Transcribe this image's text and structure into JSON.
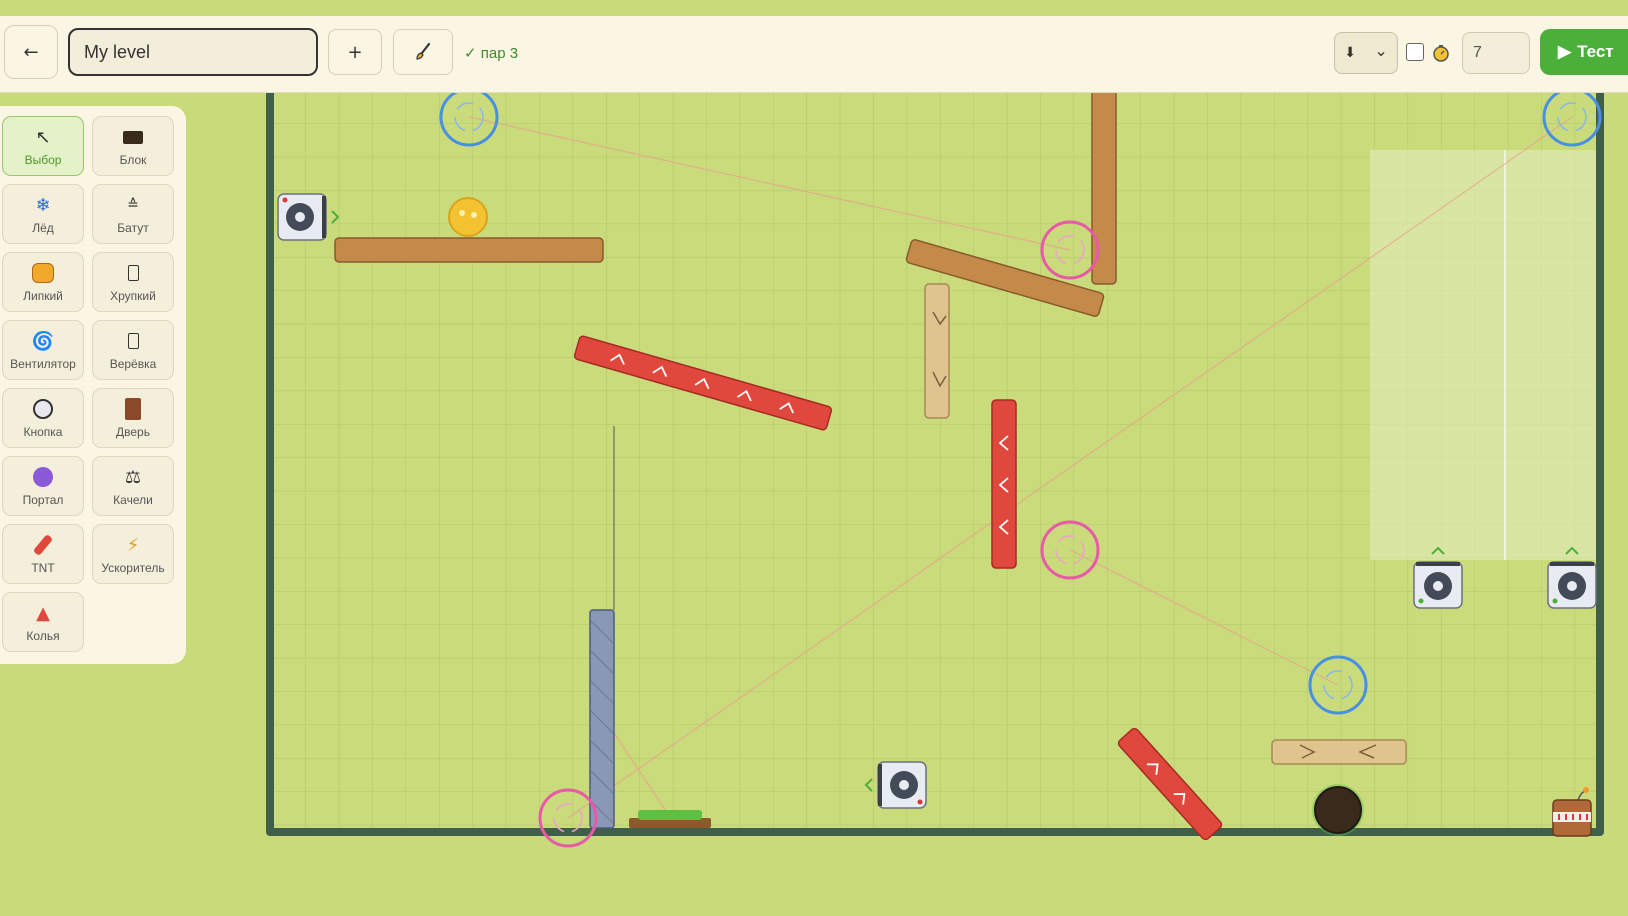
{
  "toolbar": {
    "back_label": "←",
    "level_name": "My level",
    "add_label": "+",
    "par_text": "✓ пар 3",
    "gravity_arrow": "⬇",
    "gravity_chevron": "⌄",
    "timer_value": "7",
    "test_label": "Тест",
    "timer_enabled": false
  },
  "palette": {
    "tools": [
      {
        "label": "Выбор",
        "icon": "cursor-icon",
        "active": true
      },
      {
        "label": "Блок",
        "icon": "block-icon"
      },
      {
        "label": "Лёд",
        "icon": "snowflake-icon"
      },
      {
        "label": "Батут",
        "icon": "trampoline-icon"
      },
      {
        "label": "Липкий",
        "icon": "honey-icon"
      },
      {
        "label": "Хрупкий",
        "icon": "fragile-icon"
      },
      {
        "label": "Вентилятор",
        "icon": "fan-icon"
      },
      {
        "label": "Верёвка",
        "icon": "rope-icon"
      },
      {
        "label": "Кнопка",
        "icon": "button-icon"
      },
      {
        "label": "Дверь",
        "icon": "door-icon"
      },
      {
        "label": "Портал",
        "icon": "crystal-ball-icon"
      },
      {
        "label": "Качели",
        "icon": "scales-icon"
      },
      {
        "label": "TNT",
        "icon": "tnt-icon"
      },
      {
        "label": "Ускоритель",
        "icon": "lightning-icon"
      },
      {
        "label": "Колья",
        "icon": "spikes-icon"
      }
    ]
  },
  "colors": {
    "background": "#c8da7a",
    "board_border": "#3f5f4a",
    "wood": "#c48a4a",
    "boost_red": "#e0483e",
    "portal_blue": "#4a90e2",
    "portal_pink": "#e85aa8",
    "accent_green": "#4caf3a"
  }
}
